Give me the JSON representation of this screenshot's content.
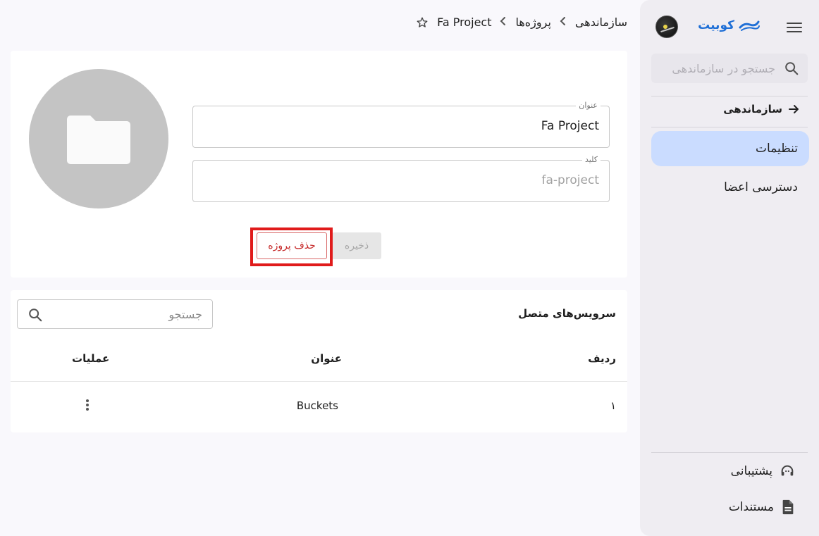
{
  "sidebar": {
    "logo_text": "کوبیت",
    "search_placeholder": "جستجو در سازماندهی",
    "back_label": "سازماندهی",
    "items": [
      {
        "label": "تنظیمات",
        "active": true
      },
      {
        "label": "دسترسی اعضا",
        "active": false
      }
    ],
    "footer": [
      {
        "label": "پشتیبانی",
        "icon": "support-icon"
      },
      {
        "label": "مستندات",
        "icon": "document-icon"
      }
    ]
  },
  "breadcrumb": {
    "items": [
      "سازماندهی",
      "پروژه‌ها",
      "Fa Project"
    ]
  },
  "project_form": {
    "title_label": "عنوان",
    "title_value": "Fa Project",
    "key_label": "کلید",
    "key_value": "fa-project",
    "save_label": "ذخیره",
    "delete_label": "حذف پروژه"
  },
  "services": {
    "title": "سرویس‌های متصل",
    "search_placeholder": "جستجو",
    "columns": [
      "ردیف",
      "عنوان",
      "عملیات"
    ],
    "rows": [
      {
        "index": "۱",
        "title": "Buckets"
      }
    ]
  },
  "colors": {
    "accent": "#1f6fd6",
    "active_bg": "#cadcff",
    "danger": "#c62828",
    "highlight": "#e01b1b"
  }
}
